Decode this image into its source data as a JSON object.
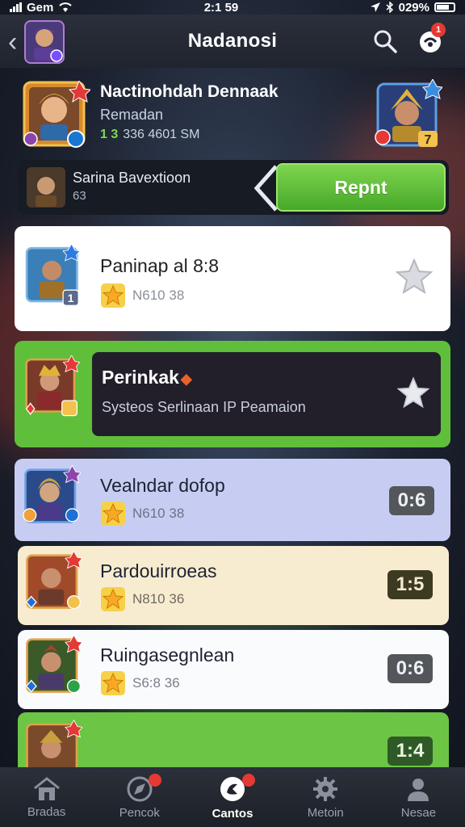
{
  "status_bar": {
    "carrier": "Gem",
    "time": "2:1 59",
    "battery": "029%"
  },
  "header": {
    "title": "Nadanosi",
    "notifications_count": "1"
  },
  "player": {
    "name": "Nactinohdah Dennaak",
    "subtitle": "Remadan",
    "level": "1 3",
    "stats": "336 4601 SM",
    "rank_badge": "7"
  },
  "challenge": {
    "name": "Sarina Bavextioon",
    "value": "63",
    "button_label": "Repnt"
  },
  "list": [
    {
      "title": "Paninap al 8:8",
      "meta": "N610 38",
      "style": "white",
      "has_fav": true,
      "score": ""
    },
    {
      "title": "Perinkak",
      "subtitle": "Systeos Serlinaan IP Peamaion",
      "style": "dark",
      "has_fav": true,
      "score": ""
    },
    {
      "title": "Vealndar dofop",
      "meta": "N610 38",
      "style": "lavender",
      "score": "0:6"
    },
    {
      "title": "Pardouirroeas",
      "meta": "N810 36",
      "style": "cream",
      "score": "1:5"
    },
    {
      "title": "Ruingasegnlean",
      "meta": "S6:8 36",
      "style": "white2",
      "score": "0:6"
    },
    {
      "title": "",
      "meta": "",
      "style": "green",
      "score": "1:4"
    }
  ],
  "nav": [
    {
      "label": "Bradas",
      "icon": "home-icon"
    },
    {
      "label": "Pencok",
      "icon": "compass-icon",
      "badge": true
    },
    {
      "label": "Cantos",
      "icon": "cards-icon",
      "badge": true,
      "active": true
    },
    {
      "label": "Metoin",
      "icon": "gear-icon"
    },
    {
      "label": "Nesae",
      "icon": "profile-icon"
    }
  ],
  "colors": {
    "accent_green": "#5fbf3a",
    "dark_panel": "#221f2a",
    "lavender": "#c7cdf2",
    "cream": "#f8ecd0",
    "score_dark": "#53565b",
    "score_olive": "#3c3a20",
    "score_green": "#2f5a28"
  }
}
